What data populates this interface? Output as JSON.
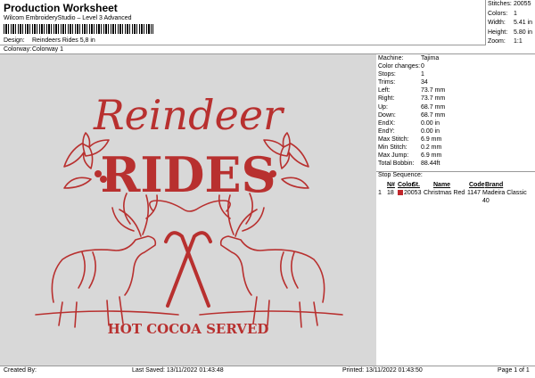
{
  "header": {
    "title": "Production Worksheet",
    "software": "Wilcom EmbroideryStudio – Level 3 Advanced",
    "design_label": "Design:",
    "design_value": "Reindeers Rides 5,8 in",
    "colorway_label": "Colorway:",
    "colorway_value": "Colorway 1"
  },
  "summary": [
    {
      "label": "Stitches:",
      "value": "20055"
    },
    {
      "label": "Colors:",
      "value": "1"
    },
    {
      "label": "Width:",
      "value": "5.41 in"
    },
    {
      "label": "Height:",
      "value": "5.80 in"
    },
    {
      "label": "Zoom:",
      "value": "1:1"
    }
  ],
  "artwork": {
    "script_word": "Reindeer",
    "title_word": "RIDES",
    "tagline": "HOT COCOA SERVED",
    "thread_color": "#b8302f",
    "background_color": "#d8d8d8"
  },
  "params": [
    {
      "label": "Machine:",
      "value": "Tajima"
    },
    {
      "label": "Color changes:",
      "value": "0"
    },
    {
      "label": "Stops:",
      "value": "1"
    },
    {
      "label": "Trims:",
      "value": "34"
    },
    {
      "label": "Left:",
      "value": "73.7 mm"
    },
    {
      "label": "Right:",
      "value": "73.7 mm"
    },
    {
      "label": "Up:",
      "value": "68.7 mm"
    },
    {
      "label": "Down:",
      "value": "68.7 mm"
    },
    {
      "label": "EndX:",
      "value": "0.00 in"
    },
    {
      "label": "EndY:",
      "value": "0.00 in"
    },
    {
      "label": "Max Stitch:",
      "value": "6.9 mm"
    },
    {
      "label": "Min Stitch:",
      "value": "0.2 mm"
    },
    {
      "label": "Max Jump:",
      "value": "6.9 mm"
    },
    {
      "label": "Total Bobbin:",
      "value": "88.44ft"
    }
  ],
  "sequence": {
    "title": "Stop Sequence:",
    "headers": {
      "n": "N#",
      "color": "Color",
      "st": "St.",
      "name": "Name",
      "code": "Code",
      "brand": "Brand"
    },
    "rows": [
      {
        "stop": "1",
        "n": "18",
        "swatch": "#c0262b",
        "st": "20053",
        "name": "Christmas Red",
        "code": "1147",
        "brand": "Madeira Classic 40"
      }
    ]
  },
  "footer": {
    "created_by": "Created By:",
    "last_saved": "Last Saved: 13/11/2022 01:43:48",
    "printed": "Printed: 13/11/2022 01:43:50",
    "page": "Page 1 of 1"
  }
}
